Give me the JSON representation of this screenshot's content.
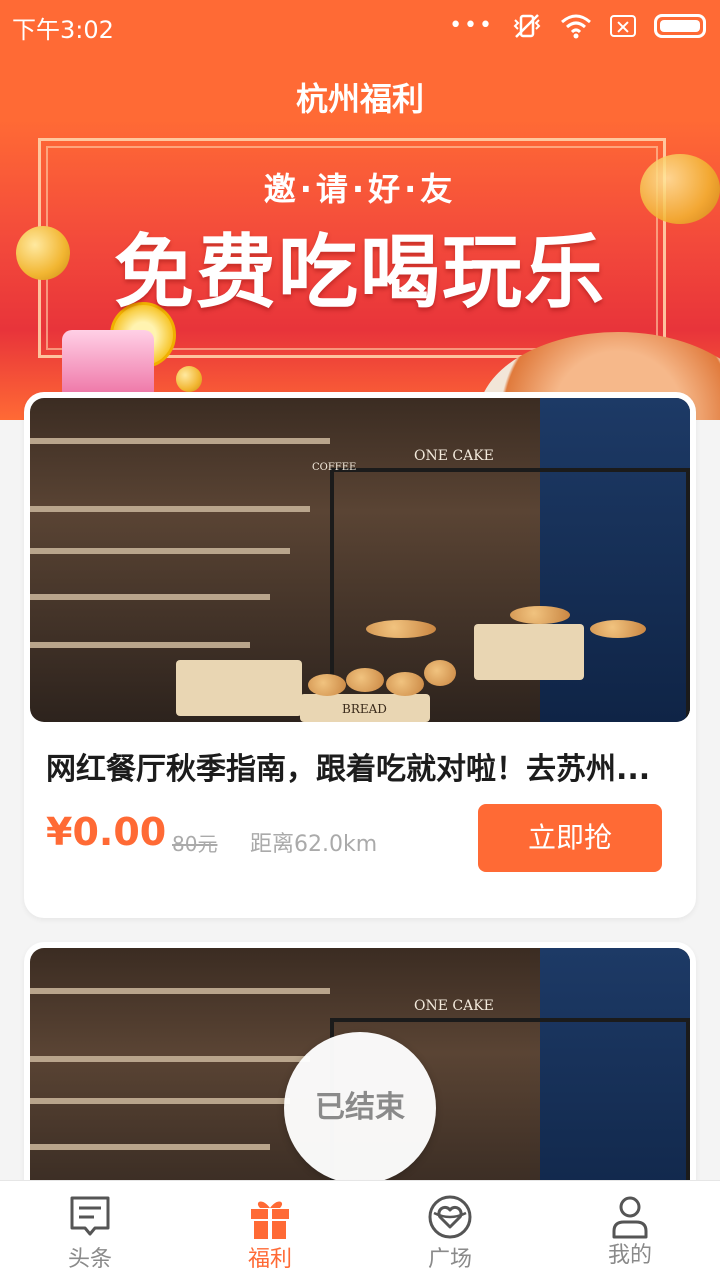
{
  "status_bar": {
    "time": "下午3:02"
  },
  "header": {
    "title": "杭州福利"
  },
  "banner": {
    "subtitle": "邀·请·好·友",
    "headline": "免费吃喝玩乐"
  },
  "photo_signs": {
    "cake_shop": "ONE CAKE",
    "bread_box": "BREAD",
    "coffee": "COFFEE"
  },
  "cards": [
    {
      "title": "网红餐厅秋季指南，跟着吃就对啦！去苏州...",
      "price": "¥0.00",
      "original_price": "80元",
      "distance": "距离62.0km",
      "button": "立即抢"
    },
    {
      "status": "已结束"
    }
  ],
  "tabs": [
    {
      "label": "头条",
      "icon": "news-icon"
    },
    {
      "label": "福利",
      "icon": "gift-icon",
      "active": true
    },
    {
      "label": "广场",
      "icon": "heart-circle-icon"
    },
    {
      "label": "我的",
      "icon": "user-icon"
    }
  ],
  "colors": {
    "accent": "#ff6a35",
    "muted": "#8a8a8a"
  }
}
